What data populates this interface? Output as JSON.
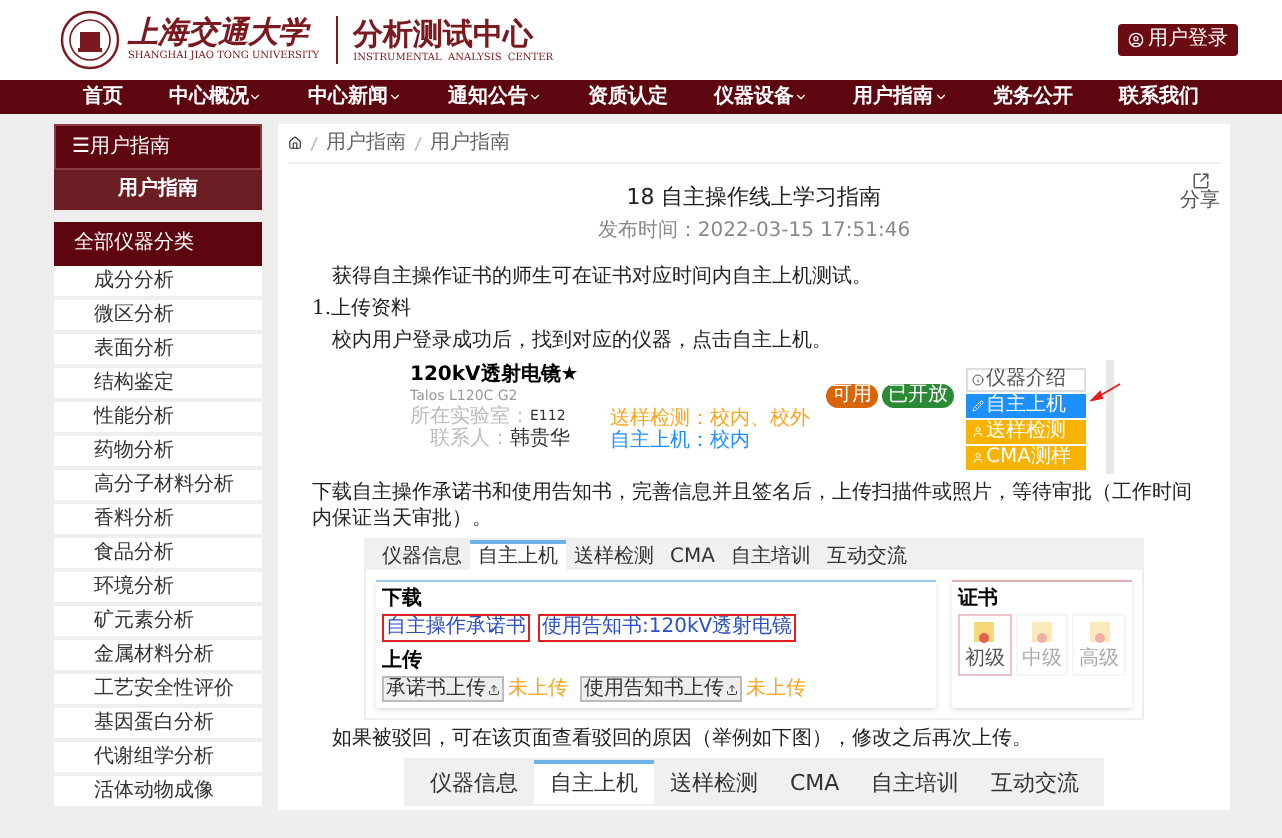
{
  "header": {
    "university_name": "上海交通大学",
    "university_name_en": "SHANGHAI JIAO TONG UNIVERSITY",
    "center_name": "分析测试中心",
    "center_name_en": "INSTRUMENTAL  ANALYSIS  CENTER",
    "login_button": "用户登录"
  },
  "nav": [
    {
      "label": "首页",
      "dropdown": false
    },
    {
      "label": "中心概况",
      "dropdown": true
    },
    {
      "label": "中心新闻",
      "dropdown": true
    },
    {
      "label": "通知公告",
      "dropdown": true
    },
    {
      "label": "资质认定",
      "dropdown": false
    },
    {
      "label": "仪器设备",
      "dropdown": true
    },
    {
      "label": "用户指南",
      "dropdown": true
    },
    {
      "label": "党务公开",
      "dropdown": false
    },
    {
      "label": "联系我们",
      "dropdown": false
    }
  ],
  "sidebar": {
    "section_title": "☰用户指南",
    "section_items": [
      {
        "label": "用户指南",
        "selected": true
      }
    ],
    "category_title": "全部仪器分类",
    "categories": [
      {
        "label": "成分分析",
        "selected": false
      },
      {
        "label": "微区分析",
        "selected": false
      },
      {
        "label": "表面分析",
        "selected": false
      },
      {
        "label": "结构鉴定",
        "selected": false
      },
      {
        "label": "性能分析",
        "selected": false
      },
      {
        "label": "药物分析",
        "selected": false
      },
      {
        "label": "高分子材料分析",
        "selected": false
      },
      {
        "label": "香料分析",
        "selected": false
      },
      {
        "label": "食品分析",
        "selected": false
      },
      {
        "label": "环境分析",
        "selected": false
      },
      {
        "label": "矿元素分析",
        "selected": false
      },
      {
        "label": "金属材料分析",
        "selected": false
      },
      {
        "label": "工艺安全性评价",
        "selected": false
      },
      {
        "label": "基因蛋白分析",
        "selected": false
      },
      {
        "label": "代谢组学分析",
        "selected": false
      },
      {
        "label": "活体动物成像",
        "selected": false
      }
    ]
  },
  "breadcrumb": [
    "用户指南",
    "用户指南"
  ],
  "article": {
    "title": "18 自主操作线上学习指南",
    "share_label": "分享",
    "publish_time": "发布时间：2022-03-15 17:51:46",
    "blocks": [
      {
        "kind": "paragraph",
        "text": "获得自主操作证书的师生可在证书对应时间内自主上机测试。",
        "indent": true
      },
      {
        "kind": "paragraph",
        "text": "1.上传资料",
        "indent": false
      },
      {
        "kind": "paragraph",
        "text": "校内用户登录成功后，找到对应的仪器，点击自主上机。",
        "indent": true
      },
      {
        "kind": "instrument_card",
        "name": "120kV透射电镜★",
        "model": "Talos L120C G2",
        "lab_label": "所在实验室：",
        "lab": "E112",
        "contact_label": "联系人：",
        "contact": "韩贵华",
        "service_sample": "送样检测：校内、校外",
        "service_self": "自主上机：校内",
        "badges": [
          {
            "label": "可用",
            "color": "#d9650a"
          },
          {
            "label": "已开放",
            "color": "#2a8a36"
          }
        ],
        "actions": [
          {
            "kind": "info",
            "label": "仪器介绍",
            "color": "#ffffff",
            "pointed": false
          },
          {
            "kind": "edit",
            "label": "自主上机",
            "color": "#1e8fff",
            "pointed": true
          },
          {
            "kind": "user",
            "label": "送样检测",
            "color": "#f7b300",
            "pointed": false
          },
          {
            "kind": "user",
            "label": "CMA测样",
            "color": "#f7b300",
            "pointed": false
          }
        ]
      },
      {
        "kind": "paragraph",
        "text": "下载自主操作承诺书和使用告知书，完善信息并且签名后，上传扫描件或照片，等待审批（工作时间内保证当天审批）。",
        "indent": false
      },
      {
        "kind": "booking_panel",
        "tabs": [
          {
            "label": "仪器信息",
            "selected": false
          },
          {
            "label": "自主上机",
            "selected": true
          },
          {
            "label": "送样检测",
            "selected": false
          },
          {
            "label": "CMA",
            "selected": false
          },
          {
            "label": "自主培训",
            "selected": false
          },
          {
            "label": "互动交流",
            "selected": false
          }
        ],
        "download_title": "下载",
        "downloads": [
          {
            "label": "自主操作承诺书",
            "boxed": true
          },
          {
            "label": "使用告知书:120kV透射电镜",
            "boxed": true
          }
        ],
        "upload_title": "上传",
        "uploads": [
          {
            "button": "承诺书上传",
            "status": "未上传"
          },
          {
            "button": "使用告知书上传",
            "status": "未上传"
          }
        ],
        "cert_title": "证书",
        "certs": [
          {
            "label": "初级",
            "active": true
          },
          {
            "label": "中级",
            "active": false
          },
          {
            "label": "高级",
            "active": false
          }
        ]
      },
      {
        "kind": "paragraph",
        "text": "如果被驳回，可在该页面查看驳回的原因（举例如下图），修改之后再次上传。",
        "indent": true
      },
      {
        "kind": "tab_strip",
        "tabs": [
          {
            "label": "仪器信息",
            "selected": false
          },
          {
            "label": "自主上机",
            "selected": true
          },
          {
            "label": "送样检测",
            "selected": false
          },
          {
            "label": "CMA",
            "selected": false
          },
          {
            "label": "自主培训",
            "selected": false
          },
          {
            "label": "互动交流",
            "selected": false
          }
        ]
      }
    ]
  }
}
